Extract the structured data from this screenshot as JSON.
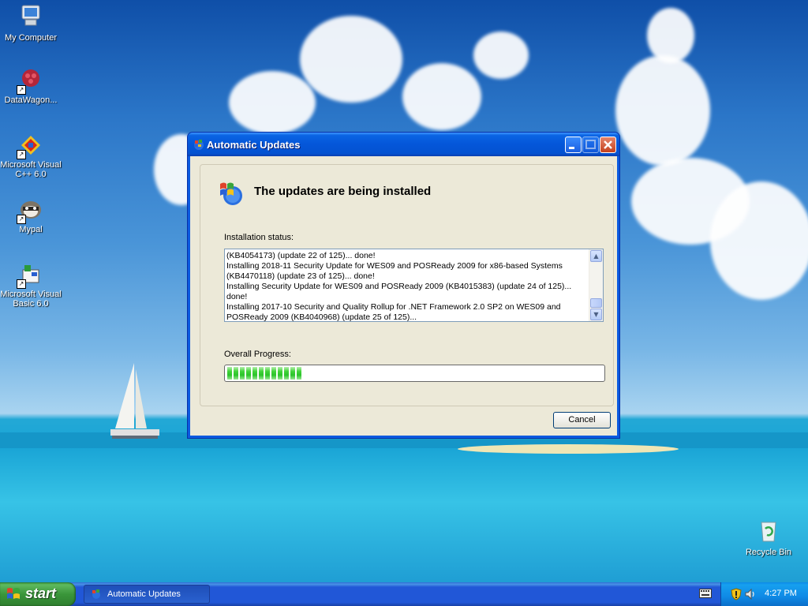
{
  "desktop": {
    "icons": [
      {
        "label": "My Computer"
      },
      {
        "label": "DataWagon..."
      },
      {
        "label": "Microsoft Visual C++ 6.0"
      },
      {
        "label": "Mypal"
      },
      {
        "label": "Microsoft Visual Basic 6.0"
      },
      {
        "label": "Recycle Bin"
      }
    ]
  },
  "window": {
    "title": "Automatic Updates",
    "heading": "The updates are being installed",
    "status_label": "Installation status:",
    "status_lines": [
      "(KB4054173) (update 22 of 125)... done!",
      "Installing 2018-11 Security Update for WES09 and POSReady 2009 for x86-based Systems",
      "(KB4470118) (update 23 of 125)... done!",
      "Installing Security Update for WES09 and POSReady 2009 (KB4015383) (update 24 of 125)...",
      "done!",
      "Installing 2017-10 Security and Quality Rollup for .NET Framework 2.0 SP2 on WES09 and",
      "POSReady 2009 (KB4040968) (update 25 of 125)..."
    ],
    "progress_label": "Overall Progress:",
    "progress_fraction": 0.2,
    "cancel_label": "Cancel"
  },
  "taskbar": {
    "start_label": "start",
    "task_label": "Automatic Updates",
    "clock": "4:27 PM"
  },
  "colors": {
    "titlebar": "#0456d9",
    "dialog_bg": "#ece9d8",
    "progress_green": "#2bc42a",
    "taskbar": "#2157d7",
    "start_green": "#3a963a"
  }
}
